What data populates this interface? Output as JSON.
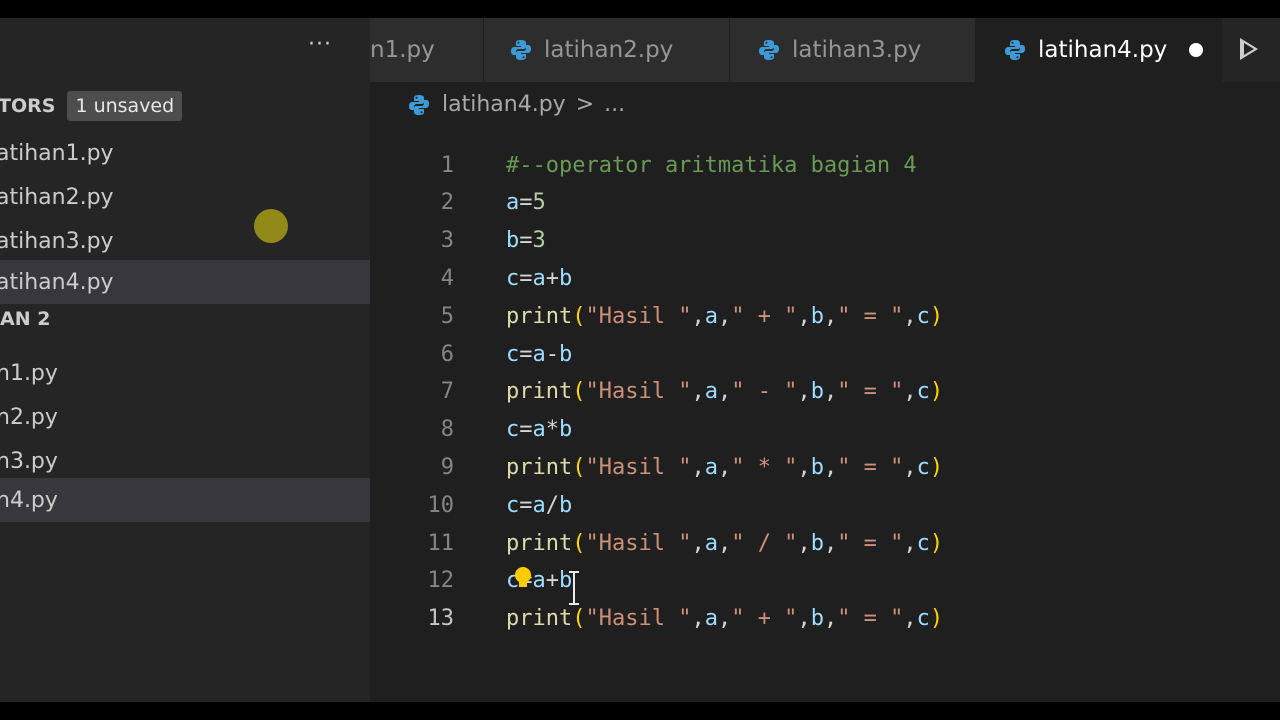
{
  "sidebar": {
    "more_label": "···",
    "open_editors": {
      "title": "TORS",
      "badge": "1 unsaved"
    },
    "open_files": [
      "atihan1.py",
      "atihan2.py",
      "atihan3.py",
      "atihan4.py"
    ],
    "folder_title": "AN 2",
    "folder_files": [
      "n1.py",
      "n2.py",
      "n3.py",
      "n4.py"
    ]
  },
  "tabs": [
    {
      "label": "n1.py"
    },
    {
      "label": "latihan2.py"
    },
    {
      "label": "latihan3.py"
    },
    {
      "label": "latihan4.py",
      "active": true,
      "unsaved": true
    }
  ],
  "breadcrumb": {
    "file": "latihan4.py",
    "sep": ">",
    "more": "..."
  },
  "colors": {
    "accent_python": "#3c9ad6",
    "comment": "#6a9955",
    "variable": "#9cdcfe",
    "function": "#dcdcaa",
    "string": "#ce9178"
  },
  "editor": {
    "current_line": 13,
    "line_numbers": [
      "1",
      "2",
      "3",
      "4",
      "5",
      "6",
      "7",
      "8",
      "9",
      "10",
      "11",
      "12",
      "13"
    ],
    "lines": [
      "#--operator aritmatika bagian 4",
      "a=5",
      "b=3",
      "c=a+b",
      "print(\"Hasil \",a,\" + \",b,\" = \",c)",
      "c=a-b",
      "print(\"Hasil \",a,\" - \",b,\" = \",c)",
      "c=a*b",
      "print(\"Hasil \",a,\" * \",b,\" = \",c)",
      "c=a/b",
      "print(\"Hasil \",a,\" / \",b,\" = \",c)",
      "c=a+b",
      "print(\"Hasil \",a,\" + \",b,\" = \",c)"
    ]
  }
}
